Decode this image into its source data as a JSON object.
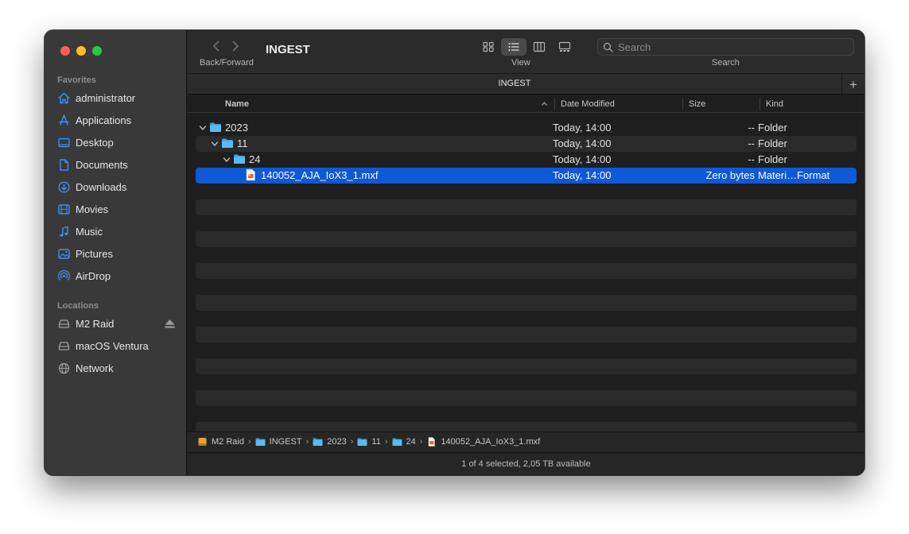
{
  "window": {
    "title": "INGEST",
    "traffic_lights": {
      "close": "#fe5f57",
      "minimize": "#febc2e",
      "zoom": "#28c840"
    }
  },
  "sidebar": {
    "favorites_label": "Favorites",
    "favorites": [
      {
        "label": "administrator",
        "icon": "home-icon"
      },
      {
        "label": "Applications",
        "icon": "applications-icon"
      },
      {
        "label": "Desktop",
        "icon": "desktop-icon"
      },
      {
        "label": "Documents",
        "icon": "document-icon"
      },
      {
        "label": "Downloads",
        "icon": "downloads-icon"
      },
      {
        "label": "Movies",
        "icon": "film-icon"
      },
      {
        "label": "Music",
        "icon": "music-note-icon"
      },
      {
        "label": "Pictures",
        "icon": "photo-icon"
      },
      {
        "label": "AirDrop",
        "icon": "airdrop-icon"
      }
    ],
    "locations_label": "Locations",
    "locations": [
      {
        "label": "M2 Raid",
        "icon": "disk-icon",
        "eject": true
      },
      {
        "label": "macOS Ventura",
        "icon": "disk-icon",
        "eject": false
      },
      {
        "label": "Network",
        "icon": "globe-icon",
        "eject": false
      }
    ],
    "accent": "#3d8ef5"
  },
  "toolbar": {
    "back_forward_label": "Back/Forward",
    "view_label": "View",
    "search_label": "Search",
    "search_placeholder": "Search",
    "active_view": "list"
  },
  "tabbar": {
    "title": "INGEST",
    "add_label": "+"
  },
  "columns": {
    "name": "Name",
    "date": "Date Modified",
    "size": "Size",
    "kind": "Kind"
  },
  "files": [
    {
      "name": "2023",
      "type": "folder",
      "depth": 0,
      "expanded": true,
      "date": "Today, 14:00",
      "size": "--",
      "kind": "Folder",
      "selected": false
    },
    {
      "name": "11",
      "type": "folder",
      "depth": 1,
      "expanded": true,
      "date": "Today, 14:00",
      "size": "--",
      "kind": "Folder",
      "selected": false
    },
    {
      "name": "24",
      "type": "folder",
      "depth": 2,
      "expanded": true,
      "date": "Today, 14:00",
      "size": "--",
      "kind": "Folder",
      "selected": false
    },
    {
      "name": "140052_AJA_IoX3_1.mxf",
      "type": "file",
      "depth": 3,
      "expanded": false,
      "date": "Today, 14:00",
      "size": "Zero bytes",
      "kind": "Materi…Format",
      "selected": true
    }
  ],
  "pathbar": [
    {
      "label": "M2 Raid",
      "icon": "disk-icon"
    },
    {
      "label": "INGEST",
      "icon": "folder-icon"
    },
    {
      "label": "2023",
      "icon": "folder-icon"
    },
    {
      "label": "11",
      "icon": "folder-icon"
    },
    {
      "label": "24",
      "icon": "folder-icon"
    },
    {
      "label": "140052_AJA_IoX3_1.mxf",
      "icon": "file-icon"
    }
  ],
  "pathbar_separator": "›",
  "status": "1 of 4 selected, 2,05 TB available",
  "colors": {
    "selection": "#0f58d6",
    "folder": "#3ca3e3"
  }
}
